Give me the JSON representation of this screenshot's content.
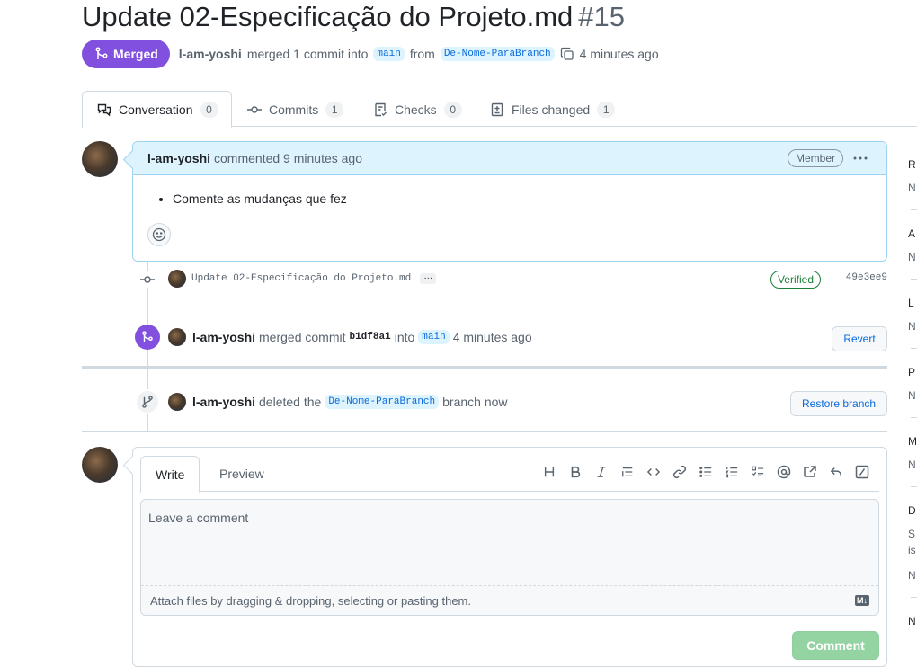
{
  "pr": {
    "title": "Update 02-Especificação do Projeto.md",
    "number": "#15",
    "state": "Merged",
    "author": "l-am-yoshi",
    "merged_text": "merged 1 commit into",
    "base_branch": "main",
    "from_text": "from",
    "head_branch": "De-Nome-ParaBranch",
    "time": "4 minutes ago"
  },
  "tabs": [
    {
      "label": "Conversation",
      "count": "0",
      "icon": "comment-discussion-icon"
    },
    {
      "label": "Commits",
      "count": "1",
      "icon": "git-commit-icon"
    },
    {
      "label": "Checks",
      "count": "0",
      "icon": "checklist-icon"
    },
    {
      "label": "Files changed",
      "count": "1",
      "icon": "file-diff-icon"
    }
  ],
  "comment": {
    "author": "l-am-yoshi",
    "when": "commented 9 minutes ago",
    "badge": "Member",
    "menu": "···",
    "body_items": [
      "Comente as mudanças que fez"
    ]
  },
  "commit": {
    "message": "Update 02-Especificação do Projeto.md",
    "ellipsis": "…",
    "verified": "Verified",
    "sha": "49e3ee9"
  },
  "merge_event": {
    "author": "l-am-yoshi",
    "text": "merged commit",
    "hash": "b1df8a1",
    "into": "into",
    "branch": "main",
    "time": "4 minutes ago",
    "button": "Revert"
  },
  "delete_event": {
    "author": "l-am-yoshi",
    "text": "deleted the",
    "branch": "De-Nome-ParaBranch",
    "suffix": "branch now",
    "button": "Restore branch"
  },
  "form": {
    "write_tab": "Write",
    "preview_tab": "Preview",
    "placeholder": "Leave a comment",
    "attach_text": "Attach files by dragging & dropping, selecting or pasting them.",
    "md_badge": "M↓",
    "submit": "Comment",
    "toolbar": [
      "heading-icon",
      "bold-icon",
      "italic-icon",
      "quote-icon",
      "code-icon",
      "link-icon",
      "unordered-list-icon",
      "ordered-list-icon",
      "task-list-icon",
      "mention-icon",
      "cross-reference-icon",
      "reply-icon",
      "slash-commands-icon"
    ]
  },
  "sidebar": {
    "items": [
      "R",
      "N",
      "A",
      "N",
      "L",
      "N",
      "P",
      "N",
      "M",
      "N",
      "D",
      "S",
      "is",
      "N",
      "N"
    ]
  }
}
